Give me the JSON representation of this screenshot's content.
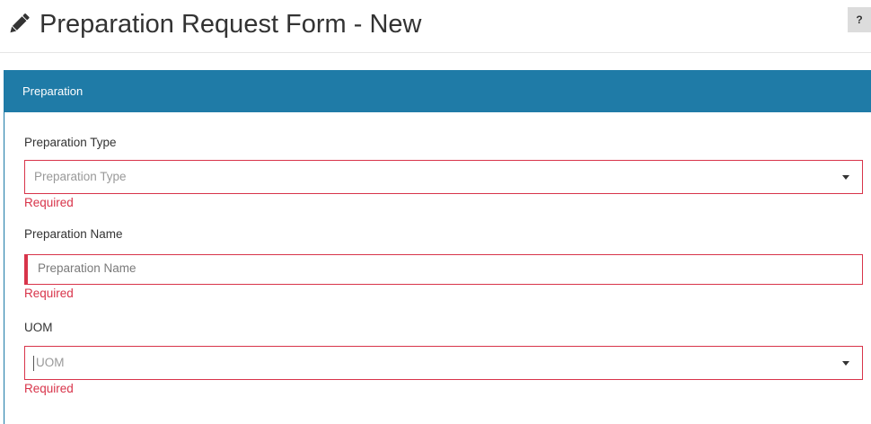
{
  "header": {
    "title": "Preparation Request Form - New",
    "help_label": "?"
  },
  "panel": {
    "heading": "Preparation"
  },
  "fields": [
    {
      "label": "Preparation Type",
      "placeholder": "Preparation Type",
      "kind": "select",
      "error": "Required"
    },
    {
      "label": "Preparation Name",
      "placeholder": "Preparation Name",
      "kind": "text",
      "error": "Required"
    },
    {
      "label": "UOM",
      "placeholder": "UOM",
      "kind": "select",
      "error": "Required"
    }
  ],
  "colors": {
    "panel_heading": "#1f7ba7",
    "error": "#d8344a"
  },
  "icons": {
    "title_icon": "pencil-icon",
    "select_caret": "caret-down-icon"
  }
}
